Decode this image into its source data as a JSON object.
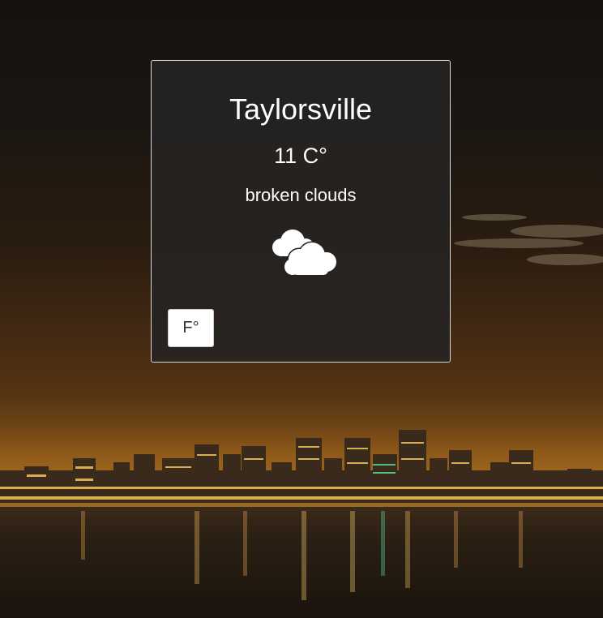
{
  "weather": {
    "city": "Taylorsville",
    "temperature": "11 C°",
    "description": "broken clouds",
    "icon": "broken-clouds-icon"
  },
  "controls": {
    "unit_toggle_label": "F°"
  },
  "background": {
    "subject": "city-skyline-at-night"
  },
  "colors": {
    "card_background": "#262422",
    "card_border": "#d8d8d8",
    "text": "#ffffff",
    "button_background": "#ffffff",
    "button_text": "#333333"
  }
}
